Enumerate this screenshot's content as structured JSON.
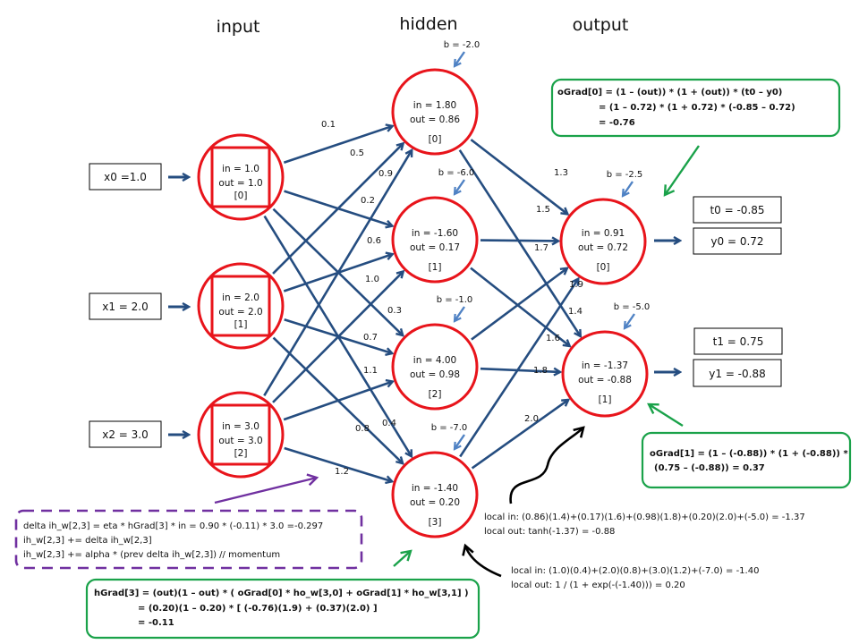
{
  "layers": {
    "input": "input",
    "hidden": "hidden",
    "output": "output"
  },
  "colors": {
    "node": "#e8141b",
    "edge": "#254d80",
    "bias_arrow": "#4f82c4",
    "green": "#1aa24a",
    "purple": "#7030a0",
    "black": "#000000"
  },
  "input_boxes": [
    "x0 =1.0",
    "x1 = 2.0",
    "x2 = 3.0"
  ],
  "input_nodes": [
    {
      "in": "in = 1.0",
      "out": "out = 1.0",
      "idx": "[0]"
    },
    {
      "in": "in = 2.0",
      "out": "out = 2.0",
      "idx": "[1]"
    },
    {
      "in": "in = 3.0",
      "out": "out = 3.0",
      "idx": "[2]"
    }
  ],
  "hidden_nodes": [
    {
      "in": "in = 1.80",
      "out": "out = 0.86",
      "idx": "[0]",
      "bias": "b = -2.0"
    },
    {
      "in": "in = -1.60",
      "out": "out = 0.17",
      "idx": "[1]",
      "bias": "b = -6.0"
    },
    {
      "in": "in = 4.00",
      "out": "out = 0.98",
      "idx": "[2]",
      "bias": "b = -1.0"
    },
    {
      "in": "in = -1.40",
      "out": "out = 0.20",
      "idx": "[3]",
      "bias": "b = -7.0"
    }
  ],
  "output_nodes": [
    {
      "in": "in = 0.91",
      "out": "out = 0.72",
      "idx": "[0]",
      "bias": "b = -2.5"
    },
    {
      "in": "in = -1.37",
      "out": "out = -0.88",
      "idx": "[1]",
      "bias": "b = -5.0"
    }
  ],
  "target_boxes": [
    "t0 = -0.85",
    "t1 = 0.75"
  ],
  "output_boxes": [
    "y0 = 0.72",
    "y1 = -0.88"
  ],
  "ih_weights": [
    {
      "from": 0,
      "to": 0,
      "label": "0.1"
    },
    {
      "from": 0,
      "to": 1,
      "label": "0.2"
    },
    {
      "from": 0,
      "to": 2,
      "label": "0.3"
    },
    {
      "from": 0,
      "to": 3,
      "label": "0.4"
    },
    {
      "from": 1,
      "to": 0,
      "label": "0.5"
    },
    {
      "from": 1,
      "to": 1,
      "label": "0.6"
    },
    {
      "from": 1,
      "to": 2,
      "label": "0.7"
    },
    {
      "from": 1,
      "to": 3,
      "label": "0.8"
    },
    {
      "from": 2,
      "to": 0,
      "label": "0.9"
    },
    {
      "from": 2,
      "to": 1,
      "label": "1.0"
    },
    {
      "from": 2,
      "to": 2,
      "label": "1.1"
    },
    {
      "from": 2,
      "to": 3,
      "label": "1.2"
    }
  ],
  "ho_weights": [
    {
      "from": 0,
      "to": 0,
      "label": "1.3"
    },
    {
      "from": 0,
      "to": 1,
      "label": "1.4"
    },
    {
      "from": 1,
      "to": 0,
      "label": "1.5"
    },
    {
      "from": 1,
      "to": 1,
      "label": "1.6"
    },
    {
      "from": 2,
      "to": 0,
      "label": "1.7"
    },
    {
      "from": 2,
      "to": 1,
      "label": "1.8"
    },
    {
      "from": 3,
      "to": 0,
      "label": "1.9"
    },
    {
      "from": 3,
      "to": 1,
      "label": "2.0"
    }
  ],
  "ograd0": {
    "line1": "oGrad[0] = (1 – (out)) * (1 + (out)) * (t0 – y0)",
    "line2": "= (1 – 0.72) * (1 + 0.72) * (-0.85 – 0.72)",
    "line3": "= -0.76"
  },
  "ograd1": {
    "line1": "oGrad[1] = (1 – (-0.88)) * (1 + (-0.88)) *",
    "line2": "(0.75 – (-0.88)) = 0.37"
  },
  "hgrad3": {
    "line1": "hGrad[3] = (out)(1 – out) * ( oGrad[0]  * ho_w[3,0]  + oGrad[1]  * ho_w[3,1]  )",
    "line2": "= (0.20)(1 – 0.20) * [  (-0.76)(1.9)  + (0.37)(2.0)  ]",
    "line3": "=  -0.11"
  },
  "delta_note": {
    "line1": "delta ih_w[2,3] = eta * hGrad[3] * in = 0.90 * (-0.11) * 3.0 =-0.297",
    "line2": "ih_w[2,3] += delta ih_w[2,3]",
    "line3": "ih_w[2,3] += alpha * (prev delta ih_w[2,3])  // momentum"
  },
  "local_out1": {
    "line1": "local in: (0.86)(1.4)+(0.17)(1.6)+(0.98)(1.8)+(0.20)(2.0)+(-5.0) = -1.37",
    "line2": "local out: tanh(-1.37) = -0.88"
  },
  "local_hid3": {
    "line1": "local in: (1.0)(0.4)+(2.0)(0.8)+(3.0)(1.2)+(-7.0) = -1.40",
    "line2": "local out: 1 / (1 + exp(-(-1.40))) = 0.20"
  }
}
